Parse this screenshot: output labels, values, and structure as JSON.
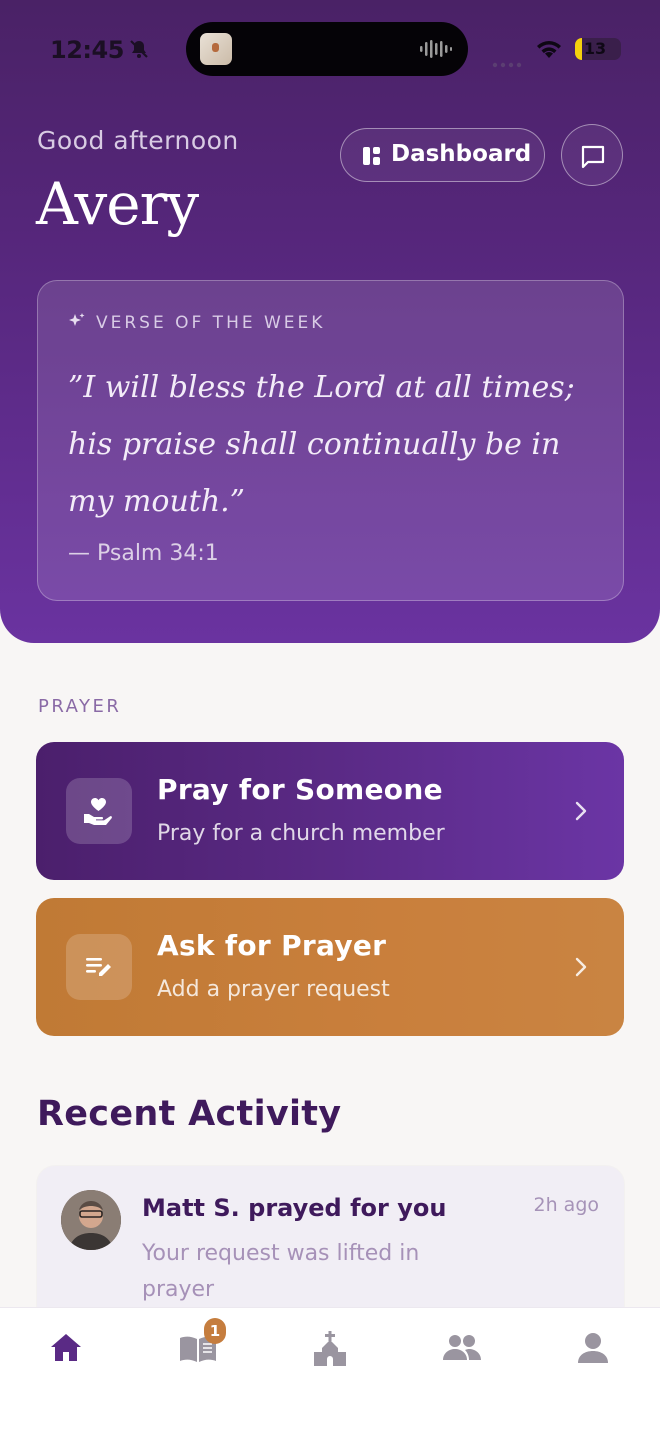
{
  "status_bar": {
    "time": "12:45",
    "battery": "13"
  },
  "header": {
    "greeting": "Good afternoon",
    "name": "Avery",
    "dashboard_label": "Dashboard"
  },
  "verse": {
    "kicker": "VERSE OF THE WEEK",
    "text": "”I will bless the Lord at all times; his praise shall continually be in my mouth.”",
    "reference": "— Psalm 34:1"
  },
  "prayer": {
    "section_label": "PRAYER",
    "pray_title": "Pray for Someone",
    "pray_subtitle": "Pray for a church member",
    "ask_title": "Ask for Prayer",
    "ask_subtitle": "Add a prayer request"
  },
  "recent": {
    "title": "Recent Activity",
    "items": [
      {
        "title": "Matt S. prayed for you",
        "time": "2h ago",
        "subtitle": "Your request was lifted in prayer"
      }
    ]
  },
  "tabbar": {
    "tabs": [
      {
        "icon": "home-icon",
        "active": true
      },
      {
        "icon": "bible-icon",
        "badge": "1"
      },
      {
        "icon": "church-icon"
      },
      {
        "icon": "group-icon"
      },
      {
        "icon": "profile-icon"
      }
    ]
  },
  "colors": {
    "primary": "#5a2a85",
    "accent": "#c57d3e",
    "text_dark": "#3f1a5c",
    "background": "#f8f6f5"
  }
}
